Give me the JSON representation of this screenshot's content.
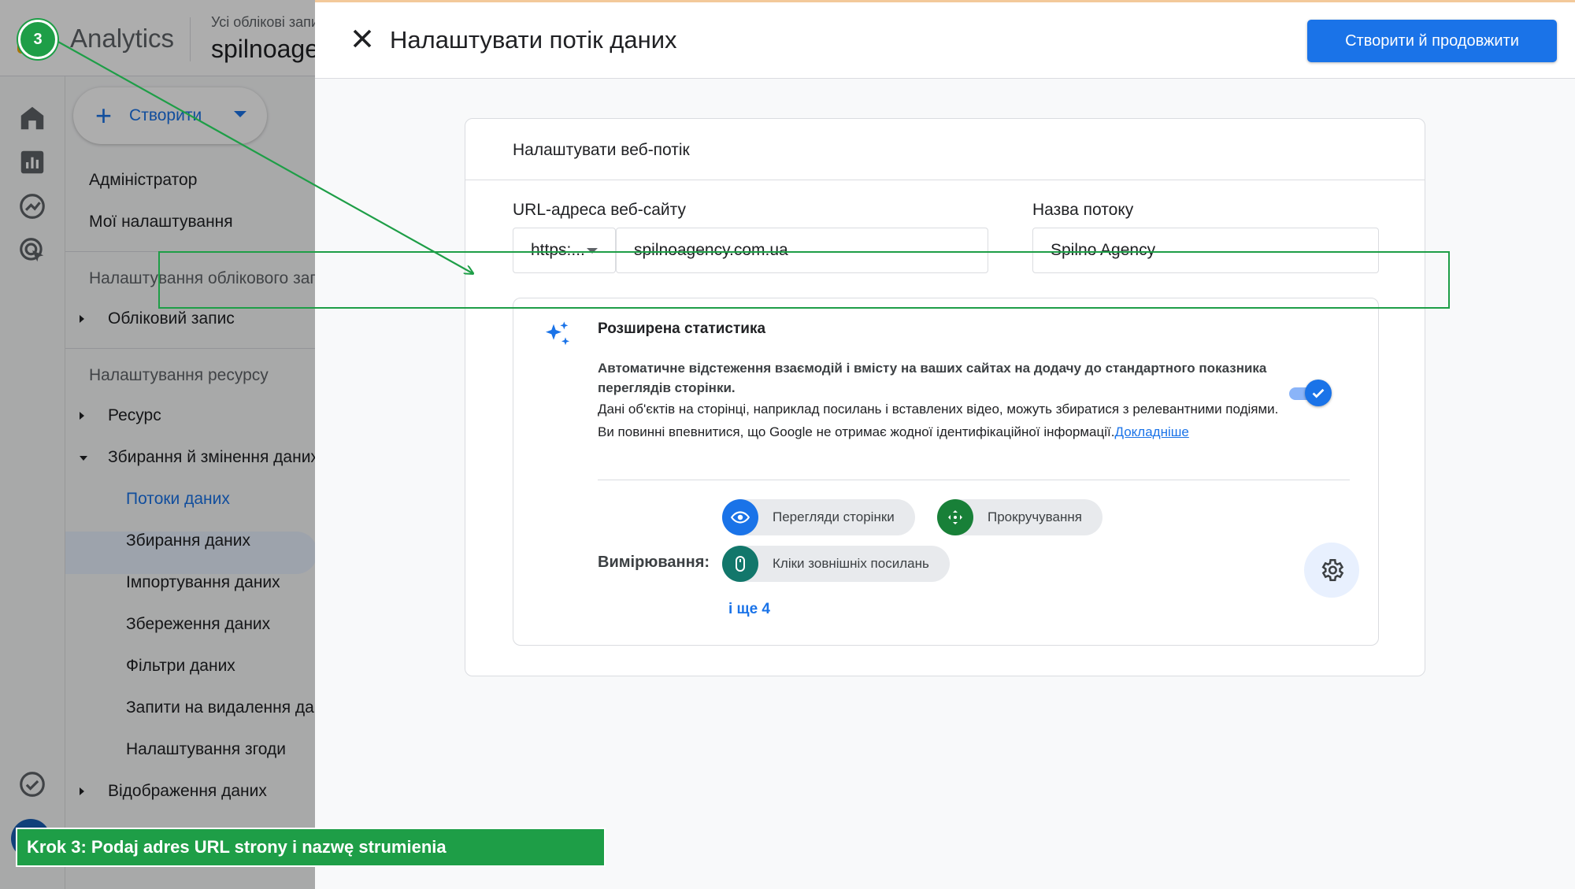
{
  "app": {
    "name": "Analytics",
    "account_label": "Усі облікові записи",
    "account_name": "spilnoagency"
  },
  "rail": {
    "icons": [
      "home-icon",
      "reports-icon",
      "explore-icon",
      "advertising-icon",
      "admin-check-icon"
    ]
  },
  "nav": {
    "create_label": "Створити",
    "items": {
      "admin": "Адміністратор",
      "my_settings": "Мої налаштування",
      "account_settings_section": "Налаштування облікового запису",
      "account": "Обліковий запис",
      "property_settings_section": "Налаштування ресурсу",
      "property": "Ресурс",
      "data_collection": "Збирання й змінення даних",
      "data_streams": "Потоки даних",
      "data_gathering": "Збирання даних",
      "data_import": "Імпортування даних",
      "data_retention": "Збереження даних",
      "data_filters": "Фільтри даних",
      "data_deletion": "Запити на видалення даних",
      "consent_settings": "Налаштування згоди",
      "data_display": "Відображення даних"
    }
  },
  "panel": {
    "title": "Налаштувати потік даних",
    "primary_button": "Створити й продовжити",
    "card_title": "Налаштувати веб-потік",
    "url_label": "URL-адреса веб-сайту",
    "protocol_value": "https:...",
    "url_value": "spilnoagency.com.ua",
    "stream_name_label": "Назва потоку",
    "stream_name_value": "Spilno Agency",
    "enhanced": {
      "title": "Розширена статистика",
      "description_bold": "Автоматичне відстеження взаємодій і вмісту на ваших сайтах на додачу до стандартного показника переглядів сторінки.",
      "description": "Дані об'єктів на сторінці, наприклад посилань і вставлених відео, можуть збиратися з релевантними подіями. Ви повинні впевнитися, що Google не отримає жодної ідентифікаційної інформації.",
      "learn_more": "Докладніше",
      "toggle_on": true,
      "measurement_label": "Вимірювання:",
      "chips": [
        {
          "label": "Перегляди сторінки",
          "icon": "eye-icon",
          "color": "#1a73e8"
        },
        {
          "label": "Прокручування",
          "icon": "scroll-icon",
          "color": "#188038"
        },
        {
          "label": "Кліки зовнішніх посилань",
          "icon": "mouse-icon",
          "color": "#12776b"
        }
      ],
      "more_link": "і ще 4"
    }
  },
  "tutorial": {
    "step_number": "3",
    "caption": "Krok 3: Podaj adres URL strony i nazwę strumienia",
    "accent_color": "#1e9e47"
  }
}
